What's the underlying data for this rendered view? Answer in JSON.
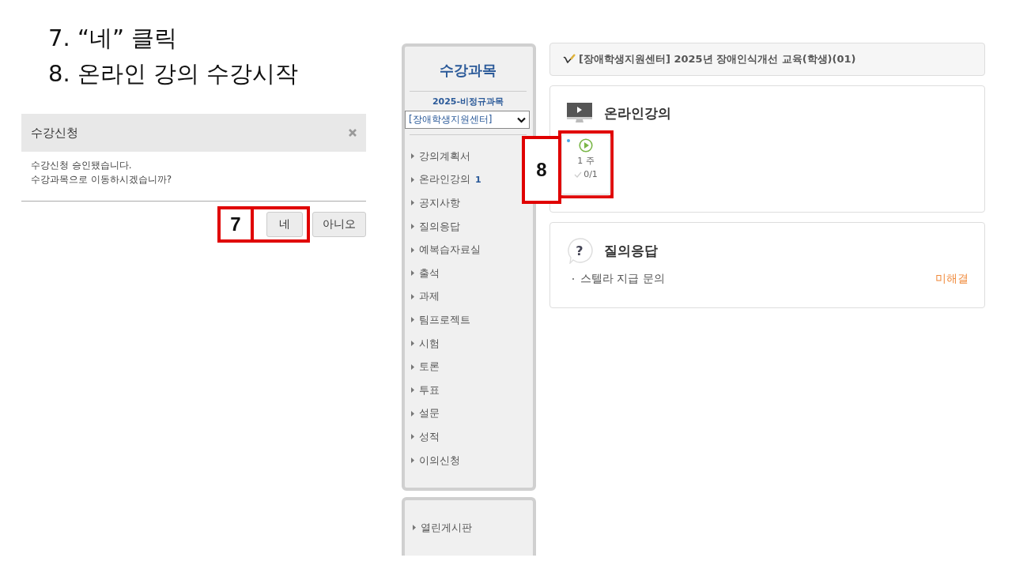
{
  "steps": [
    "7. “네” 클릭",
    "8. 온라인 강의 수강시작"
  ],
  "dialog": {
    "title": "수강신청",
    "message": [
      "수강신청 승인됐습니다.",
      "수강과목으로 이동하시겠습니까?"
    ],
    "buttons": [
      {
        "label": "네",
        "callout": "7"
      },
      {
        "label": "아니오"
      }
    ]
  },
  "sidebar": {
    "title": "수강과목",
    "term": "2025-비정규과목",
    "select": "[장애학생지원센터]",
    "items": [
      {
        "label": "강의계획서"
      },
      {
        "label": "온라인강의",
        "count": "1"
      },
      {
        "label": "공지사항"
      },
      {
        "label": "질의응답"
      },
      {
        "label": "예복습자료실"
      },
      {
        "label": "출석"
      },
      {
        "label": "과제"
      },
      {
        "label": "팀프로젝트"
      },
      {
        "label": "시험"
      },
      {
        "label": "토론"
      },
      {
        "label": "투표"
      },
      {
        "label": "설문"
      },
      {
        "label": "성적"
      },
      {
        "label": "이의신청"
      }
    ],
    "extra_items": [
      {
        "label": "열린게시판"
      }
    ]
  },
  "course_title": "[장애학생지원센터] 2025년 장애인식개선 교육(학생)(01)",
  "online": {
    "title": "온라인강의",
    "weeks": [
      {
        "label": "1 주",
        "progress": "0/1",
        "new": true,
        "callout": "8"
      }
    ]
  },
  "qna": {
    "icon": "?",
    "title": "질의응답",
    "posts": [
      {
        "title": "스텔라 지급 문의",
        "status": "미해결"
      }
    ]
  }
}
